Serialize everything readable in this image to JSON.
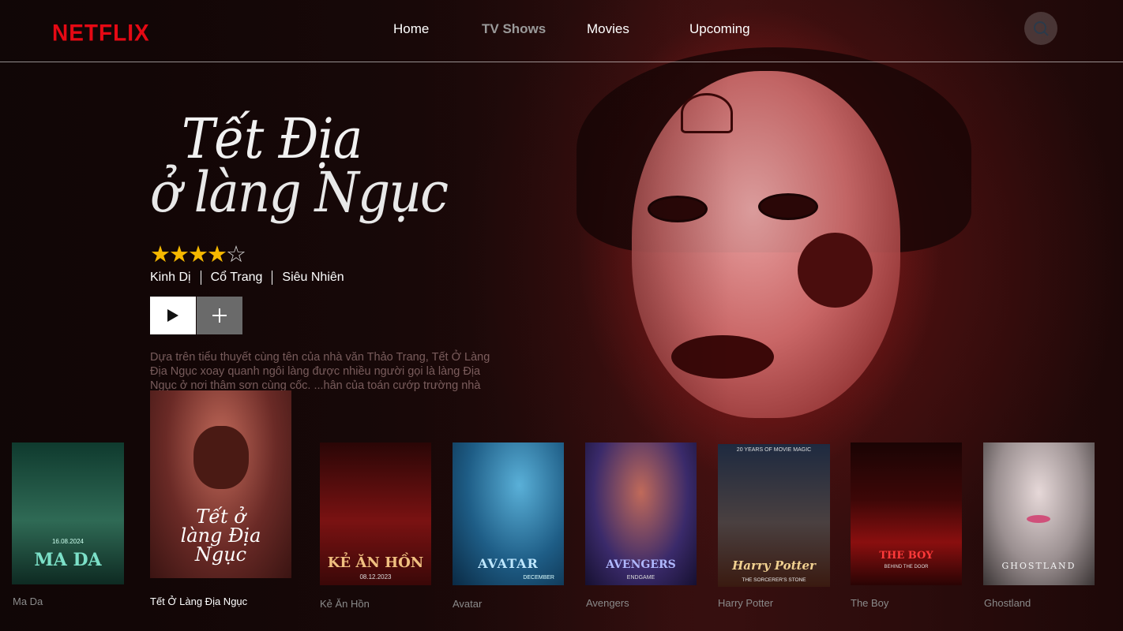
{
  "header": {
    "logo": "NETFLIX",
    "nav": [
      {
        "label": "Home",
        "active": false
      },
      {
        "label": "TV Shows",
        "active": true
      },
      {
        "label": "Movies",
        "active": false
      },
      {
        "label": "Upcoming",
        "active": false
      }
    ],
    "search_icon": "search-icon"
  },
  "featured": {
    "title_line1": "Tết Địa",
    "title_line2": "ở làng Ngục",
    "rating": 4,
    "rating_max": 5,
    "genres": [
      "Kinh Dị",
      "Cổ Trang",
      "Siêu Nhiên"
    ],
    "play_icon": "play-icon",
    "add_icon": "plus-icon",
    "description": "Dựa trên tiểu thuyết cùng tên của nhà văn Thảo Trang, Tết Ở Làng Địa Ngục xoay quanh ngôi làng được nhiều người gọi là làng Địa Ngục ở nơi thâm sơn cùng cốc. ...hân của toán cướp trường nhà Hồ, ... này sống qua ngày."
  },
  "row": [
    {
      "caption": "Ma Da",
      "poster_title": "MA DA",
      "poster_sub": "16.08.2024",
      "color": "#1f4a3a",
      "selected": false
    },
    {
      "caption": "Tết Ở Làng Địa Ngục",
      "poster_title": "Tết ở làng Địa Ngục",
      "color": "#6a2a26",
      "selected": true
    },
    {
      "caption": "Kẻ Ăn Hồn",
      "poster_title": "KẺ ĂN HỒN",
      "poster_sub": "08.12.2023",
      "color": "#5a1010",
      "selected": false
    },
    {
      "caption": "Avatar",
      "poster_title": "AVATAR",
      "poster_sub": "DECEMBER",
      "color": "#1e5d86",
      "selected": false
    },
    {
      "caption": "Avengers",
      "poster_title": "AVENGERS",
      "poster_sub": "ENDGAME",
      "color": "#3a2a6a",
      "selected": false
    },
    {
      "caption": "Harry Potter",
      "poster_title": "Harry Potter",
      "poster_sub": "THE SORCERER'S STONE",
      "poster_top": "20 YEARS OF MOVIE MAGIC",
      "color": "#3a3a4a",
      "selected": false
    },
    {
      "caption": "The Boy",
      "poster_title": "THE BOY",
      "poster_sub": "BEHIND THE DOOR",
      "color": "#3d0707",
      "selected": false
    },
    {
      "caption": "Ghostland",
      "poster_title": "GHOSTLAND",
      "color": "#9a8f90",
      "selected": false
    }
  ]
}
